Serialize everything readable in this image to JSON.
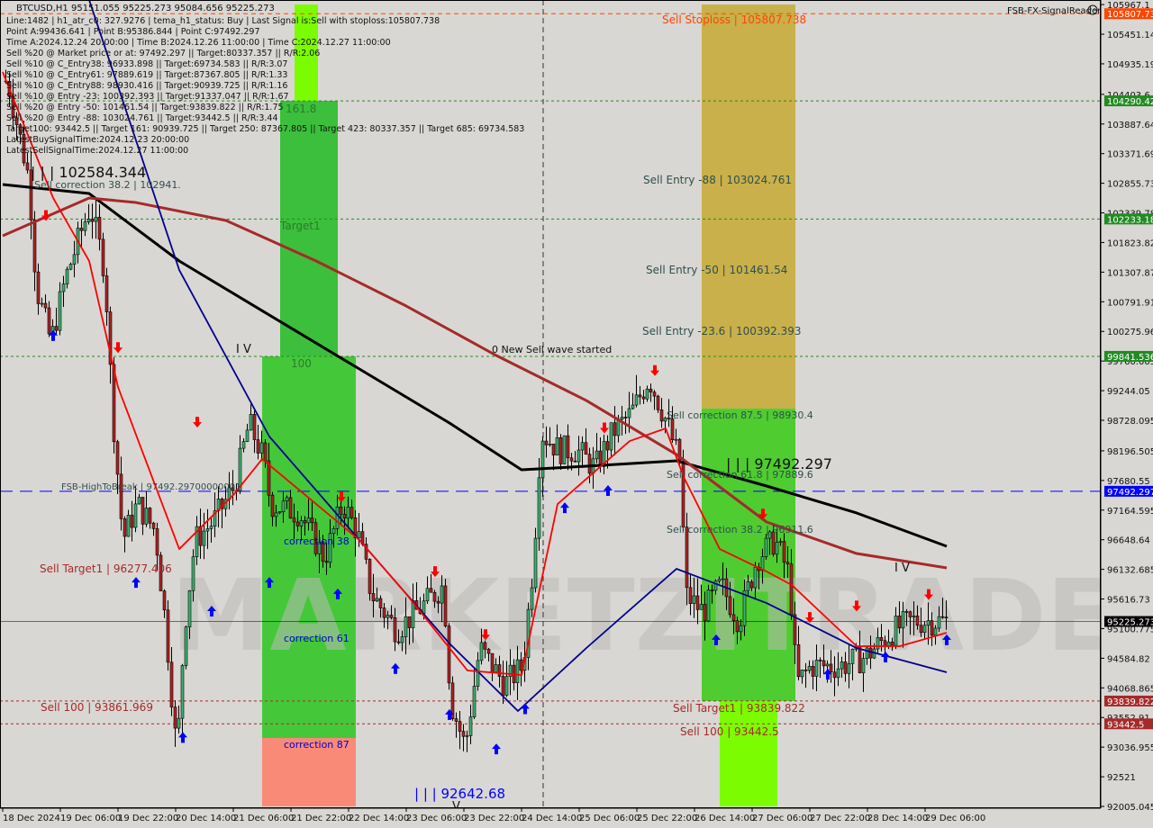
{
  "header": {
    "title": "BTCUSD,H1  95151.055 95225.273 95084.656 95225.273",
    "indicator_name": "FSB-FX-SignalReader",
    "watermark": "MARKETZITRADE"
  },
  "info_lines": [
    "Line:1482 | h1_atr_c0: 327.9276 | tema_h1_status: Buy | Last Signal is:Sell with stoploss:105807.738",
    "Point A:99436.641 | Point B:95386.844 | Point C:97492.297",
    "Time A:2024.12.24 20:00:00 | Time B:2024.12.26 11:00:00 | Time C:2024.12.27 11:00:00",
    "Sell %20 @ Market price or at: 97492.297 || Target:80337.357 || R/R:2.06",
    "Sell %10 @ C_Entry38: 96933.898 || Target:69734.583 || R/R:3.07",
    "Sell %10 @ C_Entry61: 97889.619 || Target:87367.805 || R/R:1.33",
    "Sell %10 @ C_Entry88: 98930.416 || Target:90939.725 || R/R:1.16",
    "Sell %10 @ Entry -23: 100392.393 || Target:91337.047 || R/R:1.67",
    "Sell %20 @ Entry -50: 101461.54 || Target:93839.822 || R/R:1.75",
    "Sell %20 @ Entry -88: 103024.761 || Target:93442.5 || R/R:3.44",
    "Target100: 93442.5 || Target 161: 90939.725 || Target 250: 87367.805 || Target 423: 80337.357 || Target 685: 69734.583",
    "LatestBuySignalTime:2024.12.23 20:00:00",
    "LatestSellSignalTime:2024.12.27 11:00:00"
  ],
  "labels": {
    "stoploss": "Sell Stoploss | 105807.738",
    "fib161": "161.8",
    "target1": "Target1",
    "fib100": "100",
    "corr38": "correction 38",
    "corr61": "correction 61",
    "corr87": "correction 87",
    "entry88": "Sell Entry -88 | 103024.761",
    "entry50": "Sell Entry -50 | 101461.54",
    "entry23": "Sell Entry -23.6 | 100392.393",
    "new_wave": "0 New Sell wave started",
    "scorr875": "Sell correction 87.5 | 98930.4",
    "pointc": "| | | 97492.297",
    "scorr618": "Sell correction 61.8 | 97889.6",
    "scorr382": "Sell correction 38.2 | 96911.6",
    "starget1_r": "Sell Target1 | 93839.822",
    "s100_r": "Sell 100 | 93442.5",
    "pointa_l": "| | | 102584.344",
    "scorr382_l": "Sell correction 38.2 | 102941.",
    "fsb_high": "FSB-HighToBreak | 97492.29700000001",
    "starget1_l": "Sell Target1 | 96277.406",
    "s100_l": "Sell 100 | 93861.969",
    "pointb": "| | | 92642.68",
    "iv1": "I V",
    "iv2": "I V",
    "v": "V"
  },
  "chart_data": {
    "type": "candlestick",
    "symbol": "BTCUSD",
    "timeframe": "H1",
    "ylim": [
      92005.045,
      105967.1
    ],
    "price_ticks": [
      105967.1,
      105451.145,
      104935.19,
      104403.6,
      103887.645,
      103371.69,
      102855.735,
      102339.78,
      101823.825,
      101307.87,
      100791.915,
      100275.96,
      99760.005,
      99244.05,
      98728.095,
      98196.505,
      97680.55,
      97164.595,
      96648.64,
      96132.685,
      95616.73,
      95100.775,
      94584.82,
      94068.865,
      93552.91,
      93036.955,
      92521.0,
      92005.045
    ],
    "time_labels": [
      "18 Dec 2024",
      "19 Dec 06:00",
      "19 Dec 22:00",
      "20 Dec 14:00",
      "21 Dec 06:00",
      "21 Dec 22:00",
      "22 Dec 14:00",
      "23 Dec 06:00",
      "23 Dec 22:00",
      "24 Dec 14:00",
      "25 Dec 06:00",
      "25 Dec 22:00",
      "26 Dec 14:00",
      "27 Dec 06:00",
      "27 Dec 22:00",
      "28 Dec 14:00",
      "29 Dec 06:00"
    ],
    "close_path": [
      [
        "2024-12-18 15:00",
        104636
      ],
      [
        "2024-12-18 21:00",
        102912
      ],
      [
        "2024-12-18 23:00",
        101031
      ],
      [
        "2024-12-19 03:00",
        100091
      ],
      [
        "2024-12-19 07:00",
        101188
      ],
      [
        "2024-12-19 12:00",
        102128
      ],
      [
        "2024-12-19 14:00",
        102442
      ],
      [
        "2024-12-19 18:00",
        101345
      ],
      [
        "2024-12-19 20:00",
        98994
      ],
      [
        "2024-12-19 23:00",
        96643
      ],
      [
        "2024-12-20 03:00",
        97270
      ],
      [
        "2024-12-20 08:00",
        96800
      ],
      [
        "2024-12-20 11:00",
        95076
      ],
      [
        "2024-12-20 14:00",
        92882
      ],
      [
        "2024-12-20 16:00",
        95076
      ],
      [
        "2024-12-20 19:00",
        96643
      ],
      [
        "2024-12-21 00:00",
        96957
      ],
      [
        "2024-12-21 06:00",
        97584
      ],
      [
        "2024-12-21 10:00",
        98681
      ],
      [
        "2024-12-21 14:00",
        98054
      ],
      [
        "2024-12-21 16:00",
        97270
      ],
      [
        "2024-12-22 00:00",
        97114
      ],
      [
        "2024-12-22 07:00",
        96330
      ],
      [
        "2024-12-22 12:00",
        97270
      ],
      [
        "2024-12-22 16:00",
        96800
      ],
      [
        "2024-12-22 20:00",
        95703
      ],
      [
        "2024-12-23 03:00",
        95076
      ],
      [
        "2024-12-23 11:00",
        95546
      ],
      [
        "2024-12-23 16:00",
        95860
      ],
      [
        "2024-12-23 18:00",
        93823
      ],
      [
        "2024-12-23 22:00",
        93039
      ],
      [
        "2024-12-24 02:00",
        94763
      ],
      [
        "2024-12-24 09:00",
        94136
      ],
      [
        "2024-12-24 14:00",
        94449
      ],
      [
        "2024-12-24 17:00",
        96330
      ],
      [
        "2024-12-24 19:00",
        98524
      ],
      [
        "2024-12-25 00:00",
        98210
      ],
      [
        "2024-12-25 05:00",
        98210
      ],
      [
        "2024-12-25 10:00",
        97897
      ],
      [
        "2024-12-25 15:00",
        98524
      ],
      [
        "2024-12-25 20:00",
        98838
      ],
      [
        "2024-12-26 01:00",
        99464
      ],
      [
        "2024-12-26 06:00",
        98681
      ],
      [
        "2024-12-26 10:00",
        97897
      ],
      [
        "2024-12-26 11:00",
        95703
      ],
      [
        "2024-12-26 16:00",
        95389
      ],
      [
        "2024-12-26 21:00",
        95860
      ],
      [
        "2024-12-27 02:00",
        95233
      ],
      [
        "2024-12-27 07:00",
        96330
      ],
      [
        "2024-12-27 12:00",
        96643
      ],
      [
        "2024-12-27 16:00",
        96016
      ],
      [
        "2024-12-27 18:00",
        94136
      ],
      [
        "2024-12-27 22:00",
        94449
      ],
      [
        "2024-12-28 06:00",
        94449
      ],
      [
        "2024-12-28 13:00",
        94606
      ],
      [
        "2024-12-28 21:00",
        95076
      ],
      [
        "2024-12-29 02:00",
        95233
      ],
      [
        "2024-12-29 09:00",
        95233
      ],
      [
        "2024-12-29 12:00",
        95225
      ]
    ],
    "series": [
      {
        "color": "#000000",
        "points": [
          [
            "2024-12-18 14:00",
            102834
          ],
          [
            "2024-12-19 14:00",
            102677
          ],
          [
            "2024-12-20 15:00",
            101502
          ],
          [
            "2024-12-21 16:00",
            100561
          ],
          [
            "2024-12-22 17:00",
            99621
          ],
          [
            "2024-12-23 18:00",
            98681
          ],
          [
            "2024-12-24 14:00",
            97866
          ],
          [
            "2024-12-25 08:00",
            97929
          ],
          [
            "2024-12-26 09:00",
            98023
          ],
          [
            "2024-12-27 10:00",
            97584
          ],
          [
            "2024-12-28 11:00",
            97114
          ],
          [
            "2024-12-29 12:00",
            96534
          ]
        ]
      },
      {
        "color": "#a52a2a",
        "points": [
          [
            "2024-12-18 14:00",
            101941
          ],
          [
            "2024-12-19 14:00",
            102599
          ],
          [
            "2024-12-20 03:00",
            102520
          ],
          [
            "2024-12-21 04:00",
            102207
          ],
          [
            "2024-12-22 05:00",
            101502
          ],
          [
            "2024-12-23 06:00",
            100718
          ],
          [
            "2024-12-24 07:00",
            99856
          ],
          [
            "2024-12-25 08:00",
            99072
          ],
          [
            "2024-12-26 09:00",
            98132
          ],
          [
            "2024-12-27 10:00",
            96957
          ],
          [
            "2024-12-28 11:00",
            96408
          ],
          [
            "2024-12-29 12:00",
            96158
          ]
        ]
      },
      {
        "color": "#00008b",
        "points": [
          [
            "2024-12-19 14:00",
            106047
          ],
          [
            "2024-12-20 15:00",
            101345
          ],
          [
            "2024-12-21 16:00",
            98446
          ],
          [
            "2024-12-22 17:00",
            96643
          ],
          [
            "2024-12-23 18:00",
            94841
          ],
          [
            "2024-12-24 13:00",
            93666
          ],
          [
            "2024-12-25 08:00",
            94763
          ],
          [
            "2024-12-26 09:00",
            96142
          ],
          [
            "2024-12-27 10:00",
            95546
          ],
          [
            "2024-12-28 11:00",
            94763
          ],
          [
            "2024-12-29 12:00",
            94340
          ]
        ]
      },
      {
        "color": "#ff0000",
        "points": [
          [
            "2024-12-18 14:00",
            104793
          ],
          [
            "2024-12-19 04:00",
            102599
          ],
          [
            "2024-12-19 14:00",
            101502
          ],
          [
            "2024-12-19 22:00",
            99307
          ],
          [
            "2024-12-20 15:00",
            96486
          ],
          [
            "2024-12-21 06:00",
            97427
          ],
          [
            "2024-12-21 14:00",
            98054
          ],
          [
            "2024-12-22 05:00",
            97270
          ],
          [
            "2024-12-22 17:00",
            96643
          ],
          [
            "2024-12-23 06:00",
            95703
          ],
          [
            "2024-12-23 23:00",
            94371
          ],
          [
            "2024-12-24 14:00",
            94293
          ],
          [
            "2024-12-25 00:00",
            97270
          ],
          [
            "2024-12-25 20:00",
            98367
          ],
          [
            "2024-12-26 06:00",
            98587
          ],
          [
            "2024-12-26 11:00",
            97741
          ],
          [
            "2024-12-26 21:00",
            96486
          ],
          [
            "2024-12-27 10:00",
            96095
          ],
          [
            "2024-12-27 17:00",
            95860
          ],
          [
            "2024-12-28 11:00",
            94794
          ],
          [
            "2024-12-28 23:00",
            94794
          ],
          [
            "2024-12-29 12:00",
            95029
          ]
        ]
      }
    ],
    "zones": [
      {
        "color": "#7cfc00",
        "from": "2024-12-21 23:00",
        "to": "2024-12-22 05:30",
        "top": 105967.1,
        "bottom": 104290.429
      },
      {
        "color": "#3cbf3c",
        "from": "2024-12-21 19:00",
        "to": "2024-12-22 11:00",
        "top": 104290.429,
        "bottom": 99841.536
      },
      {
        "color": "#44c83a",
        "from": "2024-12-21 14:00",
        "to": "2024-12-22 16:00",
        "top": 99841.536,
        "bottom": 93196
      },
      {
        "color": "#fa8a78",
        "from": "2024-12-21 14:00",
        "to": "2024-12-22 16:00",
        "top": 93196,
        "bottom": 92005.045
      },
      {
        "color": "#c9b04a",
        "from": "2024-12-26 16:00",
        "to": "2024-12-27 18:00",
        "top": 105967.1,
        "bottom": 98930.4
      },
      {
        "color": "#4fcc30",
        "from": "2024-12-26 16:00",
        "to": "2024-12-27 18:00",
        "top": 98930.4,
        "bottom": 93839.822
      },
      {
        "color": "#7cfc00",
        "from": "2024-12-26 21:00",
        "to": "2024-12-27 13:00",
        "top": 93839.822,
        "bottom": 92005.045
      }
    ],
    "levels": [
      {
        "price": 105807.738,
        "color": "#ff4500",
        "style": "dash",
        "label": "105807.738"
      },
      {
        "price": 104290.429,
        "color": "#228b22",
        "style": "dot",
        "label": "104290.429"
      },
      {
        "price": 102233.182,
        "color": "#228b22",
        "style": "dot",
        "label": "102233.182"
      },
      {
        "price": 99841.536,
        "color": "#228b22",
        "style": "dot",
        "label": "99841.536"
      },
      {
        "price": 97492.297,
        "color": "#0000ff",
        "style": "longdash",
        "label": "97492.297"
      },
      {
        "price": 95225.273,
        "color": "#000000",
        "style": "solid",
        "label": "95225.273"
      },
      {
        "price": 93839.822,
        "color": "#a52a2a",
        "style": "dot",
        "label": "93839.822"
      },
      {
        "price": 93442.5,
        "color": "#a52a2a",
        "style": "dot",
        "label": "93442.5"
      }
    ],
    "vline_time": "2024-12-24 20:00",
    "buy_arrows": [
      [
        "2024-12-19 04:00",
        100300
      ],
      [
        "2024-12-20 03:00",
        96000
      ],
      [
        "2024-12-20 16:00",
        93300
      ],
      [
        "2024-12-21 00:00",
        95500
      ],
      [
        "2024-12-21 16:00",
        96000
      ],
      [
        "2024-12-22 11:00",
        95800
      ],
      [
        "2024-12-23 03:00",
        94500
      ],
      [
        "2024-12-23 18:00",
        93700
      ],
      [
        "2024-12-24 07:00",
        93100
      ],
      [
        "2024-12-24 15:00",
        93800
      ],
      [
        "2024-12-25 02:00",
        97300
      ],
      [
        "2024-12-25 14:00",
        97600
      ],
      [
        "2024-12-26 20:00",
        95000
      ],
      [
        "2024-12-28 03:00",
        94400
      ],
      [
        "2024-12-28 19:00",
        94700
      ],
      [
        "2024-12-29 12:00",
        95000
      ]
    ],
    "sell_arrows": [
      [
        "2024-12-19 02:00",
        102200
      ],
      [
        "2024-12-19 22:00",
        99900
      ],
      [
        "2024-12-20 20:00",
        98600
      ],
      [
        "2024-12-22 12:00",
        97300
      ],
      [
        "2024-12-23 14:00",
        96000
      ],
      [
        "2024-12-24 04:00",
        94900
      ],
      [
        "2024-12-25 13:00",
        98500
      ],
      [
        "2024-12-26 03:00",
        99500
      ],
      [
        "2024-12-27 09:00",
        97000
      ],
      [
        "2024-12-27 22:00",
        95200
      ],
      [
        "2024-12-28 11:00",
        95400
      ],
      [
        "2024-12-29 07:00",
        95600
      ]
    ]
  }
}
